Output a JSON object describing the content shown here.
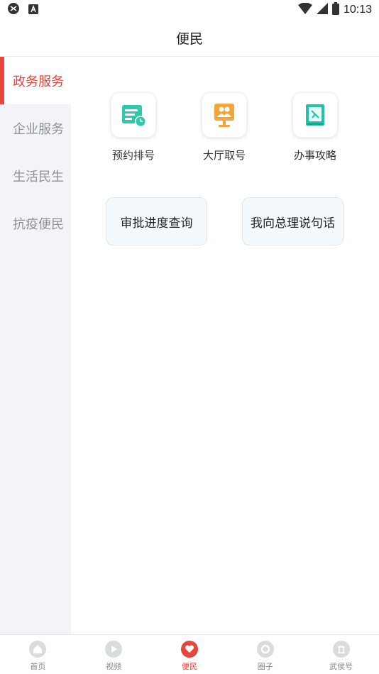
{
  "status_bar": {
    "time": "10:13"
  },
  "header": {
    "title": "便民"
  },
  "sidebar": {
    "items": [
      {
        "label": "政务服务",
        "active": true
      },
      {
        "label": "企业服务",
        "active": false
      },
      {
        "label": "生活民生",
        "active": false
      },
      {
        "label": "抗疫便民",
        "active": false
      }
    ]
  },
  "tiles": [
    {
      "label": "预约排号",
      "icon": "queue-ticket-icon"
    },
    {
      "label": "大厅取号",
      "icon": "hall-number-icon"
    },
    {
      "label": "办事攻略",
      "icon": "guide-book-icon"
    }
  ],
  "buttons": {
    "approval_query": "审批进度查询",
    "speak_to_premier": "我向总理说句话"
  },
  "bottom_nav": {
    "items": [
      {
        "label": "首页",
        "icon": "home-icon",
        "active": false
      },
      {
        "label": "视频",
        "icon": "play-icon",
        "active": false
      },
      {
        "label": "便民",
        "icon": "heart-icon",
        "active": true
      },
      {
        "label": "圈子",
        "icon": "circle-icon",
        "active": false
      },
      {
        "label": "武侯号",
        "icon": "building-icon",
        "active": false
      }
    ]
  },
  "colors": {
    "accent": "#e8453c",
    "sidebar_bg": "#f2f4f7",
    "pill_bg": "#f4f9fe"
  }
}
